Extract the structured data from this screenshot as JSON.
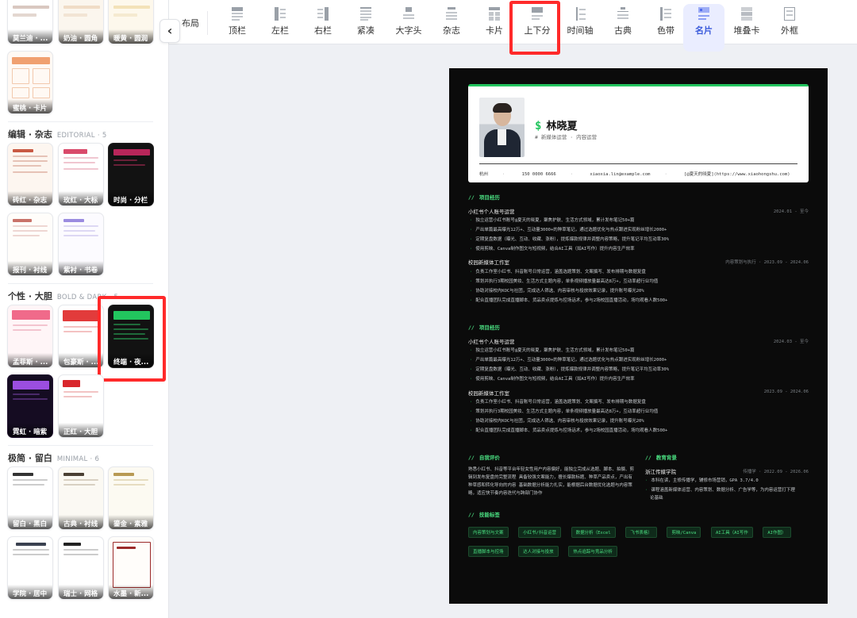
{
  "sidebar": {
    "collapse_glyph": "‹",
    "top_row": [
      "莫兰迪 · ...",
      "奶油 · 圆角",
      "暖黄 · 圆润"
    ],
    "row2": [
      "蜜桃 · 卡片"
    ],
    "sections": [
      {
        "title": "编辑 · 杂志",
        "sub": "EDITORIAL · 5",
        "items": [
          "砖红 · 杂志",
          "玫红 · 大标",
          "时尚 · 分栏",
          "报刊 · 衬线",
          "紫衬 · 书卷"
        ]
      },
      {
        "title": "个性 · 大胆",
        "sub": "BOLD & DARK · 5",
        "items": [
          "孟菲斯 · ...",
          "包豪斯 · ...",
          "终端 · 夜...",
          "霓虹 · 暗紫",
          "正红 · 大胆"
        ]
      },
      {
        "title": "极简 · 留白",
        "sub": "MINIMAL · 6",
        "items": [
          "留白 · 黑白",
          "古典 · 衬线",
          "鎏金 · 素雅",
          "学院 · 居中",
          "瑞士 · 网格",
          "水墨 · 新..."
        ]
      }
    ]
  },
  "toolbar": {
    "group_label": "布局",
    "tabs": [
      "顶栏",
      "左栏",
      "右栏",
      "紧凑",
      "大字头",
      "杂志",
      "卡片",
      "上下分",
      "时间轴",
      "古典",
      "色带",
      "名片",
      "堆叠卡",
      "外框"
    ],
    "active_tab": "名片"
  },
  "resume": {
    "accent": "#22c55e",
    "dollar": "$",
    "name": "林晓夏",
    "role_line": "# 新媒体运营  ·  内容运营",
    "contact": [
      "杭州",
      "150 0000 6666",
      "xiaoxia.lin@example.com",
      "[@夏天的晓夏](https://www.xiaohongshu.com)"
    ],
    "sections": {
      "projects_1": "项目经历",
      "projects_2": "项目经历",
      "self": "自我评价",
      "edu": "教育背景",
      "skills": "技能标签"
    },
    "job1": {
      "title": "小红书个人账号运营",
      "date": "2024.01 - 至今",
      "bullets": [
        "独立运营小红书账号@夏天的晓夏，聚焦护肤、生活方式领域，累计发布笔记50+篇",
        "产出单篇最高曝光12万+、互动量3000+的种草笔记，通过选题优化与热点跟进实现粉丝增长2000+",
        "定期复盘数据（曝光、互动、收藏、涨粉），提炼爆款规律并调整内容策略，提升笔记平均互动率30%",
        "使用剪映、Canva制作图文与短视频，结合AI工具（如AI写作）提升内容生产效率"
      ]
    },
    "job2": {
      "title": "校园新媒体工作室",
      "date": "内容策划与执行 · 2023.09 - 2024.06",
      "bullets": [
        "负责工作室小红书、抖音账号日常运营，涵盖选题策划、文案撰写、发布排期与数据复盘",
        "策划并执行3期校园美妆、生活方式主题内容，单条视频播放量最高达8万+，互动率超行业均值",
        "协助对接校内KOC与社团，完成达人筛选、内容审核与投放效果记录，提升账号曝光20%",
        "配合直播团队完成直播脚本、货品卖点提炼与控场话术，参与2场校园直播活动，场均观看人数500+"
      ]
    },
    "job3": {
      "title": "小红书个人账号运营",
      "date": "2024.03 - 至今",
      "bullets": [
        "独立运营小红书账号@夏天的晓夏，聚焦护肤、生活方式领域，累计发布笔记50+篇",
        "产出单篇最高曝光12万+、互动量3000+的种草笔记，通过选题优化与热点跟进实现粉丝增长2000+",
        "定期复盘数据（曝光、互动、收藏、涨粉），提炼爆款规律并调整内容策略，提升笔记平均互动率30%",
        "使用剪映、Canva制作图文与短视频，结合AI工具（如AI写作）提升内容生产效率"
      ]
    },
    "job4": {
      "title": "校园新媒体工作室",
      "date": "2023.09 - 2024.06",
      "bullets": [
        "负责工作室小红书、抖音账号日常运营，涵盖选题策划、文案撰写、发布排期与数据复盘",
        "策划并执行3期校园美妆、生活方式主题内容，单条视频播放量最高达8万+，互动率超行业均值",
        "协助对接校内KOC与社团，完成达人筛选、内容审核与投放效果记录，提升账号曝光20%",
        "配合直播团队完成直播脚本、货品卖点提炼与控场话术，参与2场校园直播活动，场均观看人数500+"
      ]
    },
    "self_text": "熟悉小红书、抖音等平台年轻女性用户内容偏好，能独立完成从选题、脚本、拍摄、剪辑到发布复盘的完整流程 具备较强文案能力，擅长爆款标题、种草产品卖点，产出有种草感和转化导向的内容 基础数据分析能力扎实，能根据后台数据优化选题与内容策略，适应快节奏内容迭代与跨部门协作",
    "edu": {
      "school": "浙江传媒学院",
      "date": "传播学 · 2022.09 - 2026.06",
      "lines": [
        "本科在读，主修传播学，辅修市场营销，GPA 3.7/4.0",
        "课程涵盖新媒体运营、内容策划、数据分析、广告学等，为内容运营打下理",
        "论基础"
      ]
    },
    "skills": [
      "内容策划与文案",
      "小红书/抖音运营",
      "数据分析（Excel",
      "飞书表格）",
      "剪映/Canva",
      "AI工具（AI写作",
      "AI作图）",
      "直播脚本与控场",
      "达人对接与投放",
      "热点追踪与竞品分析"
    ]
  }
}
